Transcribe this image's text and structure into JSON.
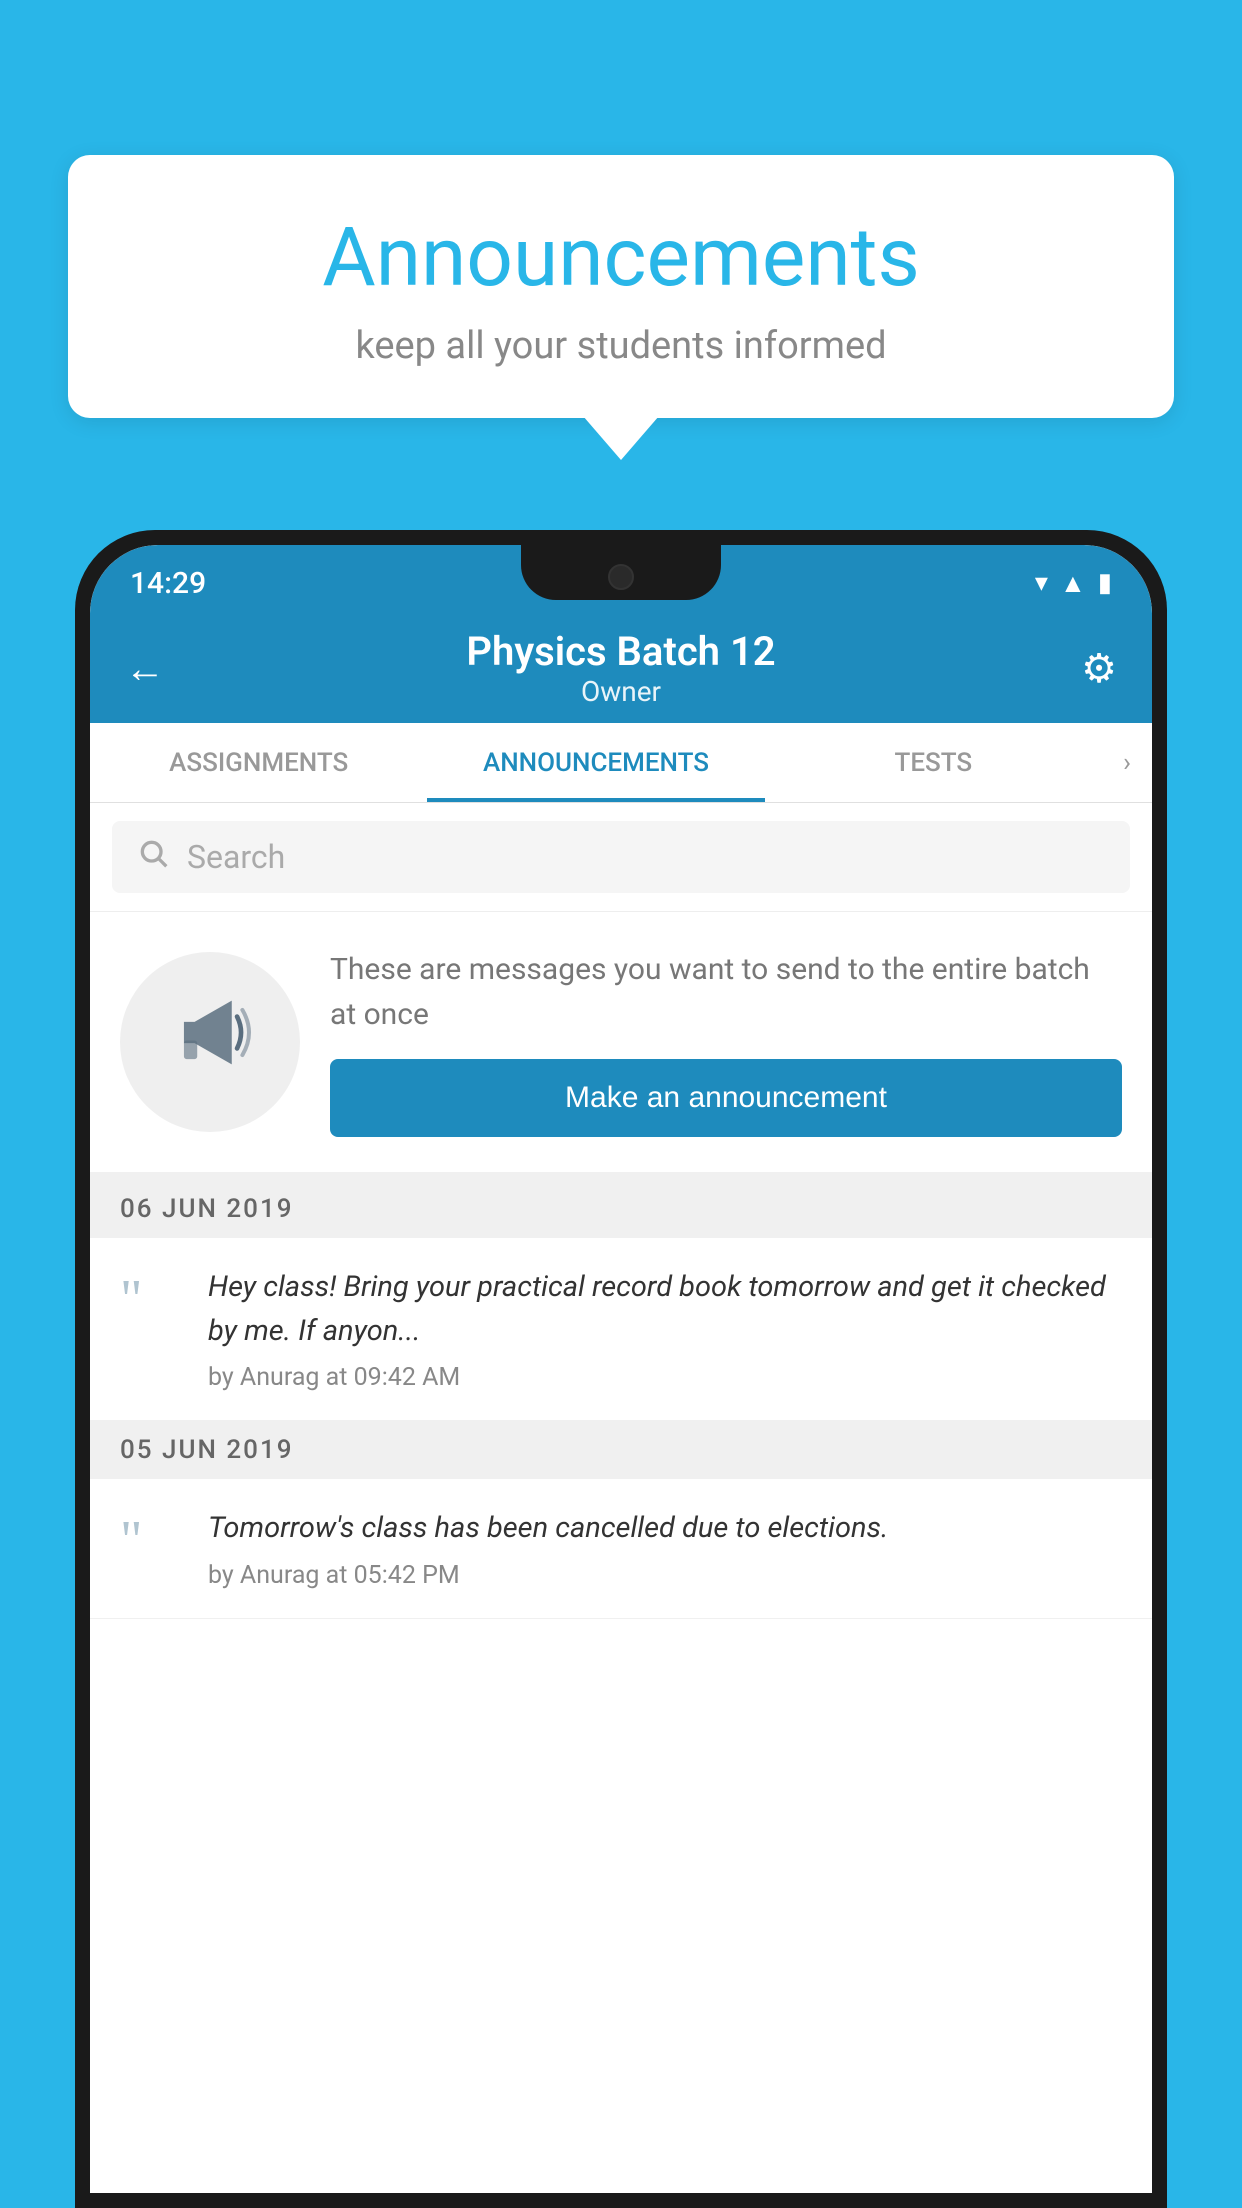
{
  "bubble": {
    "title": "Announcements",
    "subtitle": "keep all your students informed"
  },
  "status_bar": {
    "time": "14:29"
  },
  "app_bar": {
    "title": "Physics Batch 12",
    "subtitle": "Owner",
    "back_label": "←",
    "settings_label": "⚙"
  },
  "tabs": [
    {
      "id": "assignments",
      "label": "ASSIGNMENTS",
      "active": false
    },
    {
      "id": "announcements",
      "label": "ANNOUNCEMENTS",
      "active": true
    },
    {
      "id": "tests",
      "label": "TESTS",
      "active": false
    }
  ],
  "search": {
    "placeholder": "Search"
  },
  "announcement_prompt": {
    "description": "These are messages you want to send to the entire batch at once",
    "button_label": "Make an announcement"
  },
  "announcements": [
    {
      "date": "06  JUN  2019",
      "text": "Hey class! Bring your practical record book tomorrow and get it checked by me. If anyon...",
      "meta": "by Anurag at 09:42 AM"
    },
    {
      "date": "05  JUN  2019",
      "text": "Tomorrow's class has been cancelled due to elections.",
      "meta": "by Anurag at 05:42 PM"
    }
  ],
  "colors": {
    "primary": "#1e8bbd",
    "background": "#29b6e8",
    "white": "#ffffff"
  }
}
